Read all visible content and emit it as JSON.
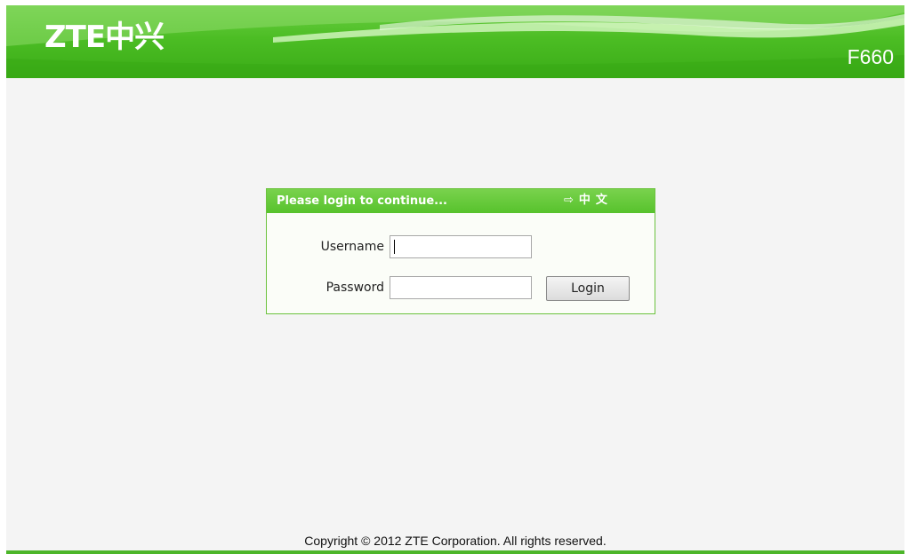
{
  "header": {
    "logo_text": "ZTE中兴",
    "model": "F660"
  },
  "login": {
    "title": "Please login to continue...",
    "language_switch": "中文",
    "username_label": "Username",
    "password_label": "Password",
    "username_value": "",
    "password_value": "",
    "login_button": "Login"
  },
  "footer": {
    "copyright": "Copyright © 2012 ZTE Corporation. All rights reserved."
  },
  "colors": {
    "brand_green": "#4cbd24",
    "border_green": "#6cc23e"
  },
  "icons": {
    "language_arrow": "arrow-right-icon"
  }
}
